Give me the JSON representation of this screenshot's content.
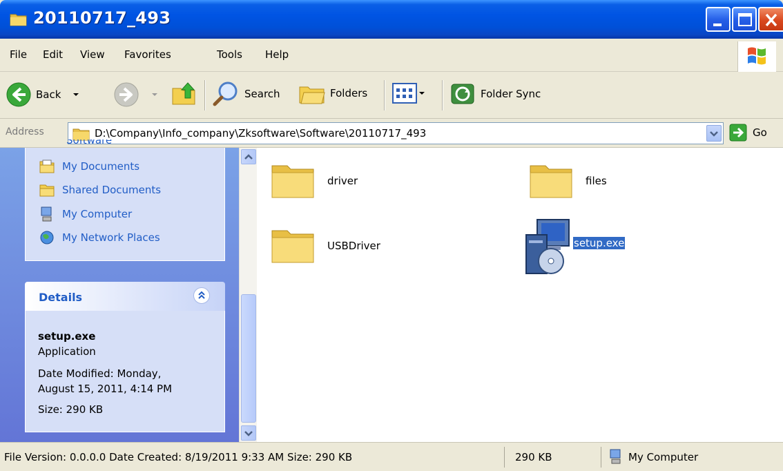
{
  "window": {
    "title": "20110717_493"
  },
  "menu": [
    "File",
    "Edit",
    "View",
    "Favorites",
    "Tools",
    "Help"
  ],
  "toolbar": {
    "back_label": "Back",
    "search_label": "Search",
    "folders_label": "Folders",
    "folder_sync_label": "Folder Sync"
  },
  "address": {
    "label": "Address",
    "path": "D:\\Company\\Info_company\\Zksoftware\\Software\\20110717_493",
    "go_label": "Go"
  },
  "left_pane": {
    "cut_item": "Software",
    "links": [
      "My Documents",
      "Shared Documents",
      "My Computer",
      "My Network Places"
    ],
    "details": {
      "title": "Details",
      "name": "setup.exe",
      "type": "Application",
      "date_line1": "Date Modified: Monday,",
      "date_line2": "August 15, 2011, 4:14 PM",
      "size": "Size: 290 KB"
    }
  },
  "files": [
    {
      "name": "driver",
      "kind": "folder"
    },
    {
      "name": "files",
      "kind": "folder"
    },
    {
      "name": "USBDriver",
      "kind": "folder"
    },
    {
      "name": "setup.exe",
      "kind": "installer",
      "selected": true
    }
  ],
  "status": {
    "info": "File Version: 0.0.0.0 Date Created: 8/19/2011 9:33 AM Size: 290 KB",
    "size": "290 KB",
    "zone": "My Computer"
  },
  "colors": {
    "title_blue": "#0054e3",
    "pane_blue": "#6f8fe0",
    "link_blue": "#215dc6",
    "selection": "#316ac5"
  }
}
